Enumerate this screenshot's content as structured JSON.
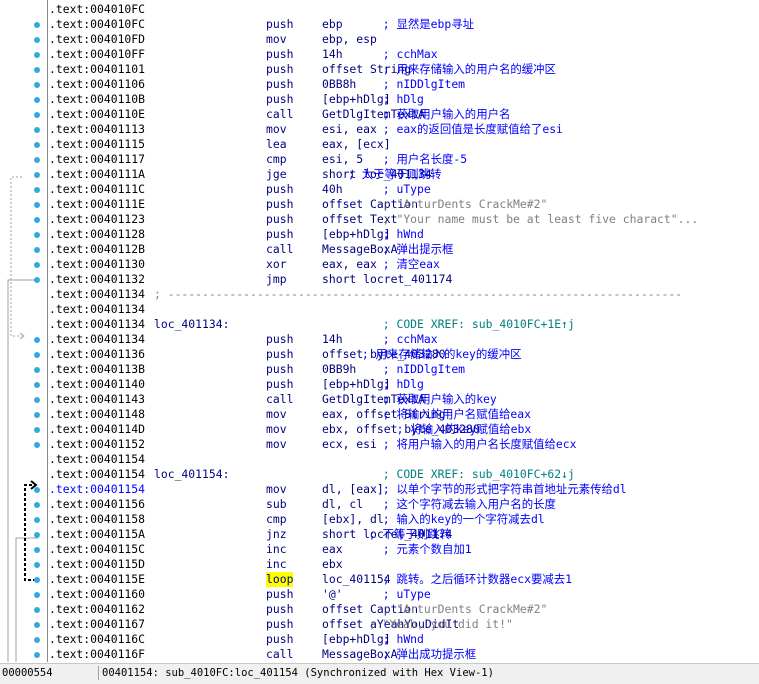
{
  "listing": [
    {
      "addr": ".text:004010FC",
      "label": "",
      "mn": "",
      "op": "",
      "cm": "",
      "arrow": false
    },
    {
      "addr": ".text:004010FC",
      "label": "",
      "mn": "push",
      "op": "ebp",
      "cm": "; 显然是ebp寻址",
      "cmcol": 35,
      "arrow": true
    },
    {
      "addr": ".text:004010FD",
      "label": "",
      "mn": "mov",
      "op": "ebp, esp",
      "cm": "",
      "arrow": true
    },
    {
      "addr": ".text:004010FF",
      "label": "",
      "mn": "push",
      "op": "14h",
      "cm": "; cchMax",
      "cmcol": 35,
      "arrow": true
    },
    {
      "addr": ".text:00401101",
      "label": "",
      "mn": "push",
      "op": "offset String",
      "cm": "; 用来存储输入的用户名的缓冲区",
      "cmcol": 35,
      "arrow": true
    },
    {
      "addr": ".text:00401106",
      "label": "",
      "mn": "push",
      "op": "0BB8h",
      "cm": "; nIDDlgItem",
      "cmcol": 35,
      "arrow": true
    },
    {
      "addr": ".text:0040110B",
      "label": "",
      "mn": "push",
      "op": "[ebp+hDlg]",
      "cm": "; hDlg",
      "cmcol": 35,
      "arrow": true
    },
    {
      "addr": ".text:0040110E",
      "label": "",
      "mn": "call",
      "op": "GetDlgItemTextA",
      "cm": "; 获取用户输入的用户名",
      "cmcol": 35,
      "arrow": true
    },
    {
      "addr": ".text:00401113",
      "label": "",
      "mn": "mov",
      "op": "esi, eax",
      "cm": "; eax的返回值是长度赋值给了esi",
      "cmcol": 35,
      "arrow": true
    },
    {
      "addr": ".text:00401115",
      "label": "",
      "mn": "lea",
      "op": "eax, [ecx]",
      "cm": "",
      "arrow": true
    },
    {
      "addr": ".text:00401117",
      "label": "",
      "mn": "cmp",
      "op": "esi, 5",
      "cm": "; 用户名长度-5",
      "cmcol": 35,
      "arrow": true
    },
    {
      "addr": ".text:0040111A",
      "label": "",
      "mn": "jge",
      "op": "short loc_401134",
      "cm": "; 大于等于则跳转",
      "cmcol": 30,
      "arrow": true
    },
    {
      "addr": ".text:0040111C",
      "label": "",
      "mn": "push",
      "op": "40h",
      "cm": "; uType",
      "cmcol": 35,
      "arrow": true
    },
    {
      "addr": ".text:0040111E",
      "label": "",
      "mn": "push",
      "op": "offset Caption",
      "cm": "; \"ArturDents CrackMe#2\"",
      "cmcol": 35,
      "cmclass": "strc",
      "arrow": true
    },
    {
      "addr": ".text:00401123",
      "label": "",
      "mn": "push",
      "op": "offset Text",
      "cm": "; \"Your name must be at least five charact\"...",
      "cmcol": 35,
      "cmclass": "strc",
      "arrow": true
    },
    {
      "addr": ".text:00401128",
      "label": "",
      "mn": "push",
      "op": "[ebp+hDlg]",
      "cm": "; hWnd",
      "cmcol": 35,
      "arrow": true
    },
    {
      "addr": ".text:0040112B",
      "label": "",
      "mn": "call",
      "op": "MessageBoxA",
      "cm": "; 弹出提示框",
      "cmcol": 35,
      "arrow": true
    },
    {
      "addr": ".text:00401130",
      "label": "",
      "mn": "xor",
      "op": "eax, eax",
      "cm": "; 清空eax",
      "cmcol": 35,
      "arrow": true
    },
    {
      "addr": ".text:00401132",
      "label": "",
      "mn": "jmp",
      "op": "short locret_401174",
      "cm": "",
      "arrow": true
    },
    {
      "addr": ".text:00401134",
      "label": "",
      "mn": "",
      "op": "",
      "cm": "",
      "sep": "; ---------------------------------------------------------------------------",
      "arrow": false
    },
    {
      "addr": ".text:00401134",
      "label": "",
      "mn": "",
      "op": "",
      "cm": "",
      "arrow": false
    },
    {
      "addr": ".text:00401134",
      "label": "loc_401134:",
      "mn": "",
      "op": "",
      "cm": "; CODE XREF: sub_4010FC+1E↑j",
      "cmcol": 35,
      "cmclass": "xref",
      "arrow": false
    },
    {
      "addr": ".text:00401134",
      "label": "",
      "mn": "push",
      "op": "14h",
      "cm": "; cchMax",
      "cmcol": 35,
      "arrow": true
    },
    {
      "addr": ".text:00401136",
      "label": "",
      "mn": "push",
      "op": "offset byte_403280",
      "cm": "; 用来存储输入的key的缓冲区",
      "cmcol": 32,
      "arrow": true
    },
    {
      "addr": ".text:0040113B",
      "label": "",
      "mn": "push",
      "op": "0BB9h",
      "cm": "; nIDDlgItem",
      "cmcol": 35,
      "arrow": true
    },
    {
      "addr": ".text:00401140",
      "label": "",
      "mn": "push",
      "op": "[ebp+hDlg]",
      "cm": "; hDlg",
      "cmcol": 35,
      "arrow": true
    },
    {
      "addr": ".text:00401143",
      "label": "",
      "mn": "call",
      "op": "GetDlgItemTextA",
      "cm": "; 获取用户输入的key",
      "cmcol": 35,
      "arrow": true
    },
    {
      "addr": ".text:00401148",
      "label": "",
      "mn": "mov",
      "op": "eax, offset String",
      "cm": "; 将输入的用户名赋值给eax",
      "cmcol": 35,
      "arrow": true
    },
    {
      "addr": ".text:0040114D",
      "label": "",
      "mn": "mov",
      "op": "ebx, offset byte_403280",
      "cm": "; 将输入的key赋值给ebx",
      "cmcol": 37,
      "arrow": true
    },
    {
      "addr": ".text:00401152",
      "label": "",
      "mn": "mov",
      "op": "ecx, esi",
      "cm": "; 将用户输入的用户名长度赋值给ecx",
      "cmcol": 35,
      "arrow": true
    },
    {
      "addr": ".text:00401154",
      "label": "",
      "mn": "",
      "op": "",
      "cm": "",
      "arrow": false
    },
    {
      "addr": ".text:00401154",
      "label": "loc_401154:",
      "mn": "",
      "op": "",
      "cm": "; CODE XREF: sub_4010FC+62↓j",
      "cmcol": 35,
      "cmclass": "xref",
      "arrow": false
    },
    {
      "addr": ".text:00401154",
      "label": "",
      "mn": "mov",
      "op": "dl, [eax]",
      "cm": "; 以单个字节的形式把字符串首地址元素传给dl",
      "cmcol": 35,
      "arrow": true,
      "cur": true
    },
    {
      "addr": ".text:00401156",
      "label": "",
      "mn": "sub",
      "op": "dl, cl",
      "cm": "; 这个字符减去输入用户名的长度",
      "cmcol": 35,
      "arrow": true
    },
    {
      "addr": ".text:00401158",
      "label": "",
      "mn": "cmp",
      "op": "[ebx], dl",
      "cm": "; 输入的key的一个字符减去dl",
      "cmcol": 35,
      "arrow": true
    },
    {
      "addr": ".text:0040115A",
      "label": "",
      "mn": "jnz",
      "op": "short locret_401174",
      "cm": "; 不等于则跳转",
      "cmcol": 33,
      "arrow": true
    },
    {
      "addr": ".text:0040115C",
      "label": "",
      "mn": "inc",
      "op": "eax",
      "cm": "; 元素个数自加1",
      "cmcol": 35,
      "arrow": true
    },
    {
      "addr": ".text:0040115D",
      "label": "",
      "mn": "inc",
      "op": "ebx",
      "cm": "",
      "arrow": true
    },
    {
      "addr": ".text:0040115E",
      "label": "",
      "mn": "loop",
      "op": "loc_401154",
      "cm": "; 跳转。之后循环计数器ecx要减去1",
      "cmcol": 35,
      "arrow": true,
      "hl": true
    },
    {
      "addr": ".text:00401160",
      "label": "",
      "mn": "push",
      "op": "'@'",
      "cm": "; uType",
      "cmcol": 35,
      "arrow": true
    },
    {
      "addr": ".text:00401162",
      "label": "",
      "mn": "push",
      "op": "offset Caption",
      "cm": "; \"ArturDents CrackMe#2\"",
      "cmcol": 35,
      "cmclass": "strc",
      "arrow": true
    },
    {
      "addr": ".text:00401167",
      "label": "",
      "mn": "push",
      "op": "offset aYeahYouDidIt",
      "cm": "; \"Yeah, you did it!\"",
      "cmcol": 33,
      "cmclass": "strc",
      "arrow": true
    },
    {
      "addr": ".text:0040116C",
      "label": "",
      "mn": "push",
      "op": "[ebp+hDlg]",
      "cm": "; hWnd",
      "cmcol": 35,
      "arrow": true
    },
    {
      "addr": ".text:0040116F",
      "label": "",
      "mn": "call",
      "op": "MessageBoxA",
      "cm": "; 弹出成功提示框",
      "cmcol": 35,
      "arrow": true
    }
  ],
  "status": {
    "offset": "00000554",
    "location": "00401154: sub_4010FC:loc_401154 (Synchronized with Hex View-1)"
  },
  "colors": {
    "breakpoint_dot": "#33aadd",
    "highlight": "#ffff00",
    "address_current": "#0000ff"
  }
}
